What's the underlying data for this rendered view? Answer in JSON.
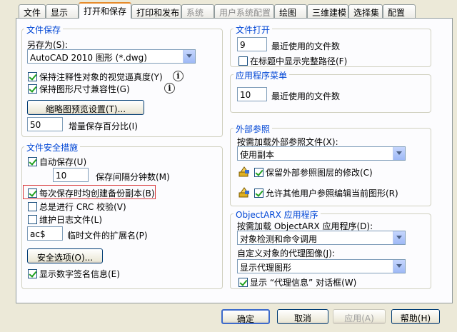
{
  "tabs": [
    {
      "label": "文件"
    },
    {
      "label": "显示"
    },
    {
      "label": "打开和保存"
    },
    {
      "label": "打印和发布"
    },
    {
      "label": "系统"
    },
    {
      "label": "用户系统配置"
    },
    {
      "label": "绘图"
    },
    {
      "label": "三维建模"
    },
    {
      "label": "选择集"
    },
    {
      "label": "配置"
    }
  ],
  "file_save": {
    "title": "文件保存",
    "save_as_label": "另存为(S):",
    "save_as_value": "AutoCAD 2010 图形 (*.dwg)",
    "annotative_fidelity": "保持注释性对象的视觉逼真度(Y)",
    "drawing_size_compat": "保持图形尺寸兼容性(G)",
    "thumbnail_button": "缩略图预览设置(T)...",
    "incremental_value": "50",
    "incremental_label": "增量保存百分比(I)"
  },
  "file_safety": {
    "title": "文件安全措施",
    "autosave": "自动保存(U)",
    "autosave_minutes_value": "10",
    "autosave_minutes_label": "保存间隔分钟数(M)",
    "backup_copy": "每次保存时均创建备份副本(B)",
    "crc_check": "总是进行 CRC 校验(V)",
    "log_file": "维护日志文件(L)",
    "temp_ext_value": "ac$",
    "temp_ext_label": "临时文件的扩展名(P)",
    "security_button": "安全选项(O)...",
    "digital_sig": "显示数字签名信息(E)"
  },
  "file_open": {
    "title": "文件打开",
    "recent_value": "9",
    "recent_label": "最近使用的文件数",
    "full_path": "在标题中显示完整路径(F)"
  },
  "app_menu": {
    "title": "应用程序菜单",
    "recent_value": "10",
    "recent_label": "最近使用的文件数"
  },
  "xref": {
    "title": "外部参照",
    "demand_load_label": "按需加载外部参照文件(X):",
    "demand_load_value": "使用副本",
    "retain_layer": "保留外部参照图层的修改(C)",
    "allow_edit": "允许其他用户参照编辑当前图形(R)"
  },
  "objectarx": {
    "title": "ObjectARX 应用程序",
    "demand_load_label": "按需加载 ObjectARX 应用程序(D):",
    "demand_load_value": "对象检测和命令调用",
    "proxy_image_label": "自定义对象的代理图像(J):",
    "proxy_image_value": "显示代理图形",
    "proxy_dialog": "显示 “代理信息” 对话框(W)"
  },
  "footer": {
    "ok": "确定",
    "cancel": "取消",
    "apply": "应用(A)",
    "help": "帮助(H)"
  }
}
